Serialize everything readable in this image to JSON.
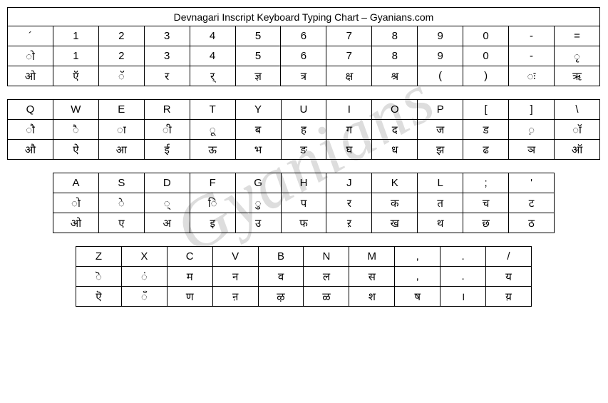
{
  "title": "Devnagari Inscript Keyboard Typing Chart – Gyanians.com",
  "watermark": "Gyanians",
  "rows": [
    {
      "indent": 0,
      "cols": 13,
      "keys": [
        "´",
        "1",
        "2",
        "3",
        "4",
        "5",
        "6",
        "7",
        "8",
        "9",
        "0",
        "-",
        "="
      ],
      "base": [
        "ो",
        "1",
        "2",
        "3",
        "4",
        "5",
        "6",
        "7",
        "8",
        "9",
        "0",
        "-",
        "ृ"
      ],
      "shift": [
        "ओ",
        "ऍ",
        "ॅ",
        "र",
        "र्",
        "ज्ञ",
        "त्र",
        "क्ष",
        "श्र",
        "(",
        ")",
        "ः",
        "ऋ"
      ]
    },
    {
      "indent": 0,
      "cols": 13,
      "keys": [
        "Q",
        "W",
        "E",
        "R",
        "T",
        "Y",
        "U",
        "I",
        "O",
        "P",
        "[",
        "]",
        "\\"
      ],
      "base": [
        "ौ",
        "ै",
        "ा",
        "ी",
        "ू",
        "ब",
        "ह",
        "ग",
        "द",
        "ज",
        "ड",
        "़",
        "ॉ"
      ],
      "shift": [
        "औ",
        "ऐ",
        "आ",
        "ई",
        "ऊ",
        "भ",
        "ङ",
        "घ",
        "ध",
        "झ",
        "ढ",
        "ञ",
        "ऑ"
      ]
    },
    {
      "indent": 64,
      "cols": 11,
      "keys": [
        "A",
        "S",
        "D",
        "F",
        "G",
        "H",
        "J",
        "K",
        "L",
        ";",
        "'"
      ],
      "base": [
        "ो",
        "े",
        "्",
        "ि",
        "ु",
        "प",
        "र",
        "क",
        "त",
        "च",
        "ट"
      ],
      "shift": [
        "ओ",
        "ए",
        "अ",
        "इ",
        "उ",
        "फ",
        "ऱ",
        "ख",
        "थ",
        "छ",
        "ठ"
      ]
    },
    {
      "indent": 96,
      "cols": 10,
      "keys": [
        "Z",
        "X",
        "C",
        "V",
        "B",
        "N",
        "M",
        ",",
        ".",
        "/"
      ],
      "base": [
        "ॆ",
        "ं",
        "म",
        "न",
        "व",
        "ल",
        "स",
        ",",
        ".",
        "य"
      ],
      "shift": [
        "ऎ",
        "ँ",
        "ण",
        "ऩ",
        "ऴ",
        "ळ",
        "श",
        "ष",
        "।",
        "य़"
      ]
    }
  ]
}
